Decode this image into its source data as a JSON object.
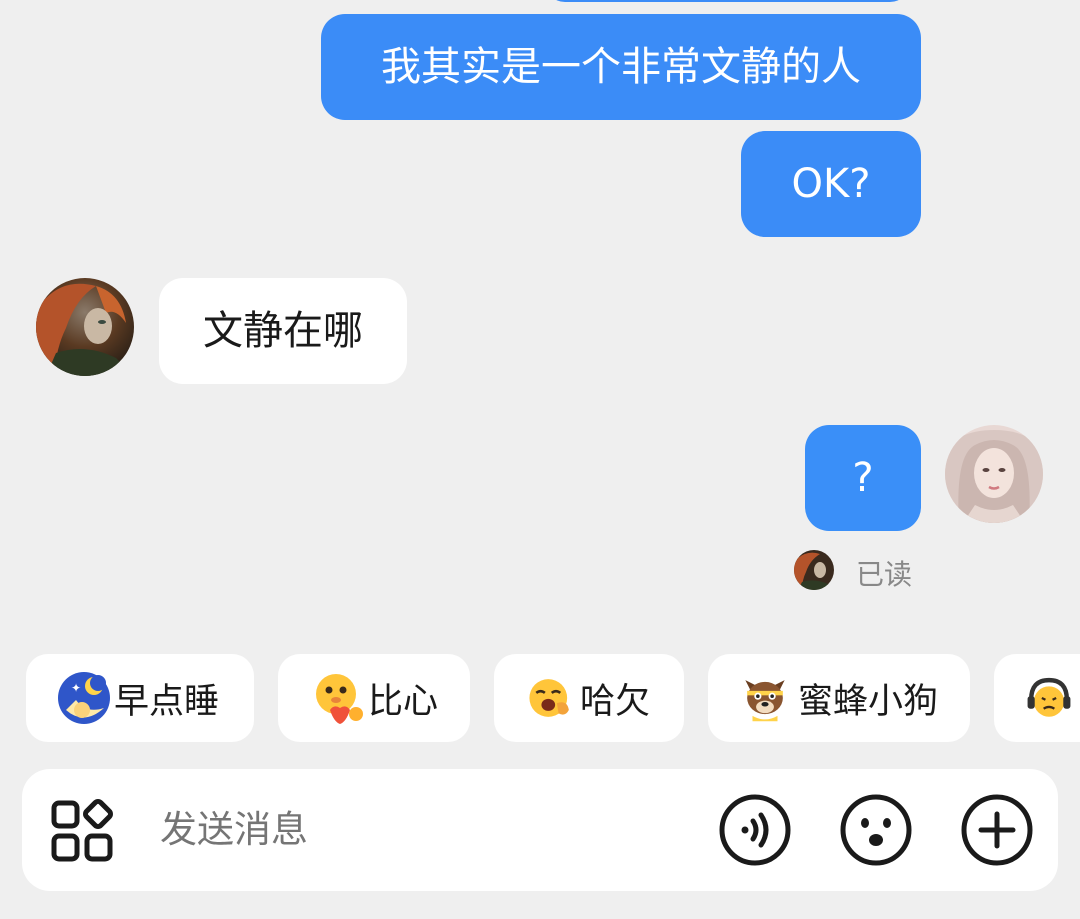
{
  "messages": [
    {
      "id": "m1",
      "side": "out",
      "text": "我其实是一个非常文静的人"
    },
    {
      "id": "m2",
      "side": "out",
      "text": "OK?"
    },
    {
      "id": "m3",
      "side": "in",
      "text": "文静在哪"
    },
    {
      "id": "m4",
      "side": "out",
      "text": "?"
    }
  ],
  "read_receipt": {
    "label": "已读"
  },
  "quick_replies": [
    {
      "label": "早点睡",
      "icon": "moon-sleep-emoji-icon"
    },
    {
      "label": "比心",
      "icon": "finger-heart-emoji-icon"
    },
    {
      "label": "哈欠",
      "icon": "yawn-emoji-icon"
    },
    {
      "label": "蜜蜂小狗",
      "icon": "bee-dog-emoji-icon"
    },
    {
      "label": "",
      "icon": "headphone-emoji-icon"
    }
  ],
  "composer": {
    "placeholder": "发送消息",
    "apps_icon": "apps-grid-icon",
    "voice_icon": "voice-icon",
    "emoji_icon": "emoji-face-icon",
    "add_icon": "plus-icon"
  },
  "colors": {
    "background": "#efefef",
    "outgoing_bubble": "#3b8cf7",
    "incoming_bubble": "#ffffff",
    "icon_stroke": "#1a1a1a"
  }
}
